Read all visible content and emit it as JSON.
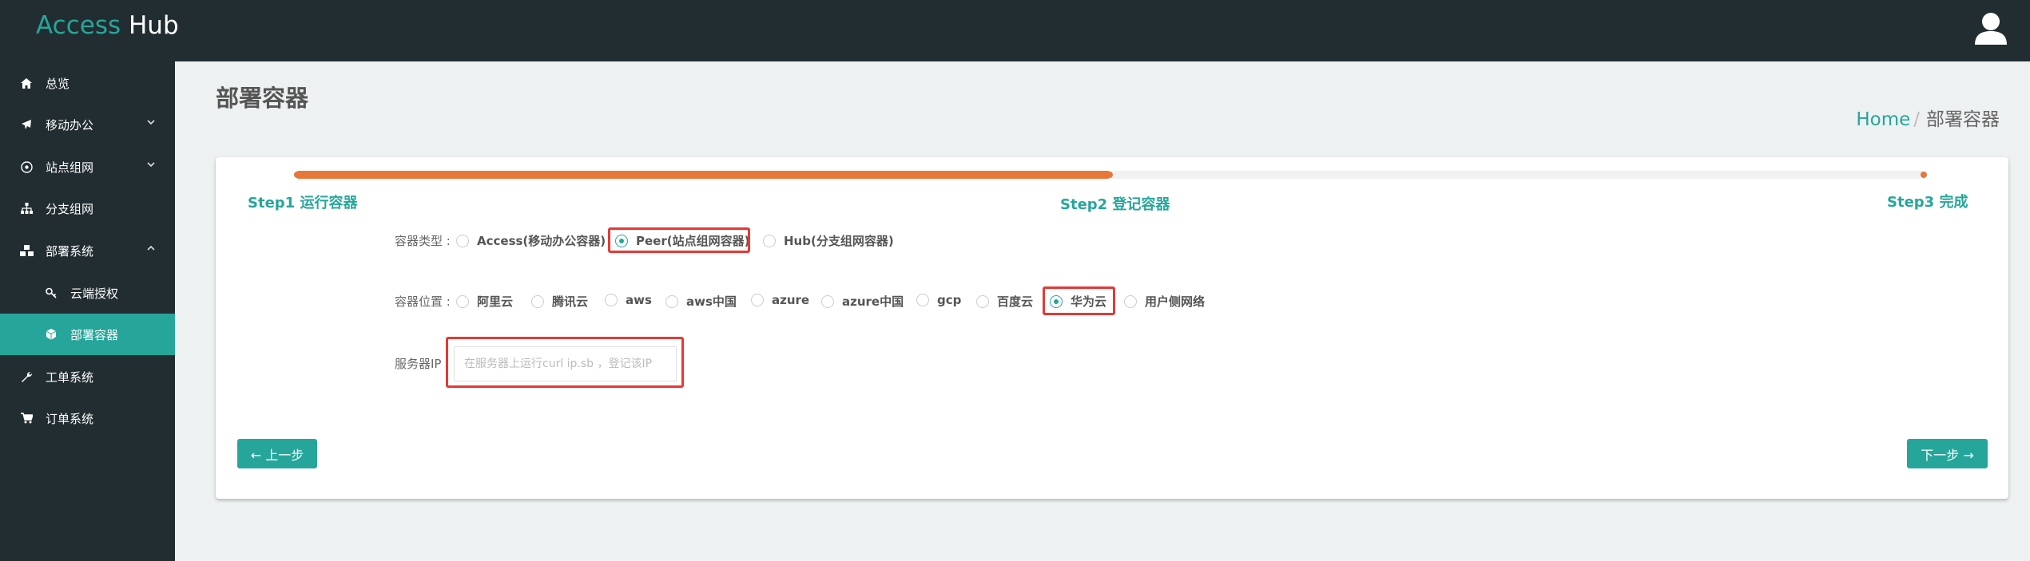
{
  "app": {
    "brand_part1": "Access",
    "brand_part2": "Hub"
  },
  "header": {
    "user_icon": "user-icon"
  },
  "sidebar": {
    "items": [
      {
        "label": "总览",
        "icon": "home-icon",
        "expandable": false
      },
      {
        "label": "移动办公",
        "icon": "plane-icon",
        "expandable": true,
        "expanded": false
      },
      {
        "label": "站点组网",
        "icon": "network-icon",
        "expandable": true,
        "expanded": false
      },
      {
        "label": "分支组网",
        "icon": "sitemap-icon",
        "expandable": false
      },
      {
        "label": "部署系统",
        "icon": "cubes-icon",
        "expandable": true,
        "expanded": true
      },
      {
        "label": "云端授权",
        "icon": "key-icon",
        "sub": true
      },
      {
        "label": "部署容器",
        "icon": "cube-icon",
        "sub": true,
        "active": true
      },
      {
        "label": "工单系统",
        "icon": "wrench-icon",
        "expandable": false
      },
      {
        "label": "订单系统",
        "icon": "cart-icon",
        "expandable": false
      }
    ],
    "active_color": "#26a69a"
  },
  "page": {
    "title": "部署容器",
    "breadcrumb": {
      "home": "Home",
      "separator": "/",
      "current": "部署容器"
    }
  },
  "wizard": {
    "progress_color": "#e8773a",
    "progress_fraction": 0.5,
    "current_step": 2,
    "steps": [
      "Step1 运行容器",
      "Step2 登记容器",
      "Step3 完成"
    ]
  },
  "form": {
    "type_label": "容器类型 :",
    "type_options": [
      "Access(移动办公容器)",
      "Peer(站点组网容器)",
      "Hub(分支组网容器)"
    ],
    "type_selected": "Peer(站点组网容器)",
    "location_label": "容器位置 :",
    "location_options": [
      "阿里云",
      "腾讯云",
      "aws",
      "aws中国",
      "azure",
      "azure中国",
      "gcp",
      "百度云",
      "华为云",
      "用户侧网络"
    ],
    "location_selected": "华为云",
    "ip_label": "服务器IP",
    "ip_placeholder": "在服务器上运行curl ip.sb ，登记该IP",
    "ip_value": ""
  },
  "buttons": {
    "prev": "← 上一步",
    "next": "下一步 →"
  },
  "highlight_color": "#e53935"
}
